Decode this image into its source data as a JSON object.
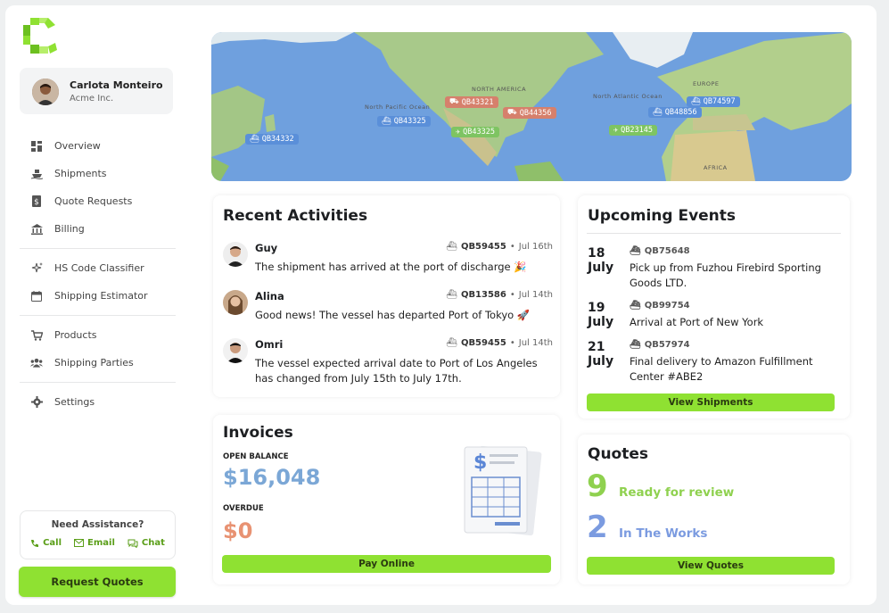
{
  "user": {
    "name": "Carlota Monteiro",
    "org": "Acme Inc."
  },
  "nav": {
    "overview": "Overview",
    "shipments": "Shipments",
    "quote_requests": "Quote Requests",
    "billing": "Billing",
    "hs_code": "HS Code Classifier",
    "shipping_estimator": "Shipping Estimator",
    "products": "Products",
    "shipping_parties": "Shipping Parties",
    "settings": "Settings"
  },
  "assist": {
    "title": "Need Assistance?",
    "call": "Call",
    "email": "Email",
    "chat": "Chat"
  },
  "request_quotes": "Request Quotes",
  "map": {
    "labels": [
      "NORTH AMERICA",
      "North Pacific Ocean",
      "North Atlantic Ocean",
      "EUROPE",
      "AFRICA"
    ],
    "tags": [
      "QB34332",
      "QB43325",
      "QB43321",
      "QB44356",
      "QB43325",
      "QB48856",
      "QB74597",
      "QB23145"
    ]
  },
  "recent": {
    "title": "Recent Activities",
    "items": [
      {
        "name": "Guy",
        "code": "QB59455",
        "date": "Jul 16th",
        "msg": "The shipment has arrived at the port of discharge 🎉"
      },
      {
        "name": "Alina",
        "code": "QB13586",
        "date": "Jul 14th",
        "msg": "Good news! The vessel has departed Port of Tokyo 🚀"
      },
      {
        "name": "Omri",
        "code": "QB59455",
        "date": "Jul 14th",
        "msg": "The vessel expected arrival date to Port of Los Angeles has changed from July 15th to July 17th."
      }
    ]
  },
  "events": {
    "title": "Upcoming Events",
    "items": [
      {
        "day": "18",
        "month": "July",
        "code": "QB75648",
        "text": "Pick up from Fuzhou Firebird Sporting Goods LTD."
      },
      {
        "day": "19",
        "month": "July",
        "code": "QB99754",
        "text": "Arrival at Port of New York"
      },
      {
        "day": "21",
        "month": "July",
        "code": "QB57974",
        "text": "Final delivery to Amazon Fulfillment Center #ABE2"
      }
    ],
    "button": "View Shipments"
  },
  "invoices": {
    "title": "Invoices",
    "open_label": "OPEN BALANCE",
    "open_value": "$16,048",
    "overdue_label": "OVERDUE",
    "overdue_value": "$0",
    "button": "Pay Online"
  },
  "quotes": {
    "title": "Quotes",
    "ready_num": "9",
    "ready_label": "Ready for review",
    "works_num": "2",
    "works_label": "In The Works",
    "button": "View Quotes"
  },
  "colors": {
    "accent": "#8fe132",
    "blue_value": "#7ba7d6",
    "orange_value": "#e89272",
    "ready_green": "#8fd14f",
    "works_blue": "#7b9be0"
  }
}
